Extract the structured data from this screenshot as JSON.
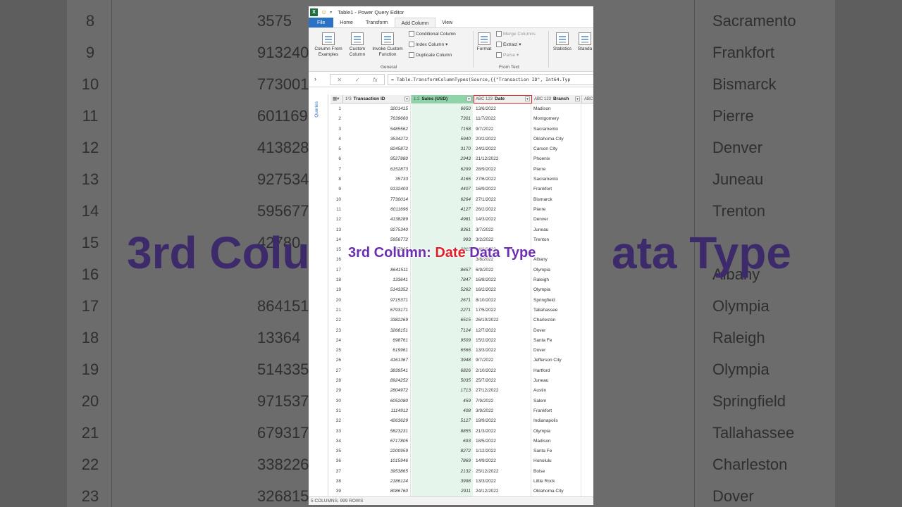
{
  "window": {
    "title": "Table1 - Power Query Editor"
  },
  "tabs": [
    {
      "label": "File"
    },
    {
      "label": "Home"
    },
    {
      "label": "Transform"
    },
    {
      "label": "Add Column"
    },
    {
      "label": "View"
    }
  ],
  "ribbon": {
    "column_from_examples": "Column From Examples",
    "custom_column": "Custom Column",
    "invoke_custom_function": "Invoke Custom Function",
    "conditional_column": "Conditional Column",
    "index_column": "Index Column",
    "duplicate_column": "Duplicate Column",
    "general_group": "General",
    "format": "Format",
    "merge_columns": "Merge Columns",
    "extract": "Extract",
    "parse": "Parse",
    "from_text_group": "From Text",
    "statistics": "Statistics",
    "standard": "Standa"
  },
  "formula": {
    "text": "= Table.TransformColumnTypes(Source,{{\"Transaction ID\", Int64.Typ"
  },
  "queries_label": "Queries",
  "columns": [
    {
      "type": "1²3",
      "name": "Transaction ID"
    },
    {
      "type": "1.2",
      "name": "Sales (USD)"
    },
    {
      "type": "ABC 123",
      "name": "Date"
    },
    {
      "type": "ABC 123",
      "name": "Branch"
    },
    {
      "type": "ABC 123",
      "name": ""
    }
  ],
  "rows": [
    [
      "1",
      "3201415",
      "6650",
      "13/6/2022",
      "Madison"
    ],
    [
      "2",
      "7639660",
      "7301",
      "11/7/2022",
      "Montgomery"
    ],
    [
      "3",
      "5485562",
      "7158",
      "9/7/2022",
      "Sacramento"
    ],
    [
      "4",
      "3534272",
      "5940",
      "20/2/2022",
      "Oklahoma City"
    ],
    [
      "5",
      "8245872",
      "3170",
      "24/2/2022",
      "Carson City"
    ],
    [
      "6",
      "9527880",
      "2943",
      "21/12/2022",
      "Phoenix"
    ],
    [
      "7",
      "6152873",
      "6299",
      "28/9/2022",
      "Pierre"
    ],
    [
      "8",
      "35733",
      "4166",
      "27/6/2022",
      "Sacramento"
    ],
    [
      "9",
      "9132403",
      "4407",
      "16/9/2022",
      "Frankfort"
    ],
    [
      "10",
      "7730014",
      "6264",
      "27/1/2022",
      "Bismarck"
    ],
    [
      "11",
      "6011696",
      "4127",
      "26/2/2022",
      "Pierre"
    ],
    [
      "12",
      "4138289",
      "4981",
      "14/3/2022",
      "Denver"
    ],
    [
      "13",
      "9275340",
      "8361",
      "3/7/2022",
      "Juneau"
    ],
    [
      "14",
      "5956772",
      "993",
      "3/2/2022",
      "Trenton"
    ],
    [
      "15",
      "427805",
      "8815",
      "24/3/2022",
      ""
    ],
    [
      "16",
      "",
      "",
      "3/8/2022",
      "Albany"
    ],
    [
      "17",
      "8641511",
      "8657",
      "6/9/2022",
      "Olympia"
    ],
    [
      "18",
      "133641",
      "7847",
      "16/8/2022",
      "Raleigh"
    ],
    [
      "19",
      "5143352",
      "5262",
      "16/2/2022",
      "Olympia"
    ],
    [
      "20",
      "9715371",
      "2671",
      "8/10/2022",
      "Springfield"
    ],
    [
      "21",
      "6793171",
      "2271",
      "17/5/2022",
      "Tallahassee"
    ],
    [
      "22",
      "3382269",
      "6515",
      "26/10/2022",
      "Charleston"
    ],
    [
      "23",
      "3268151",
      "7124",
      "12/7/2022",
      "Dover"
    ],
    [
      "24",
      "698761",
      "9509",
      "15/2/2022",
      "Santa Fe"
    ],
    [
      "25",
      "619961",
      "6566",
      "13/3/2022",
      "Dover"
    ],
    [
      "26",
      "4161367",
      "3948",
      "9/7/2022",
      "Jefferson City"
    ],
    [
      "27",
      "3839541",
      "6826",
      "2/10/2022",
      "Hartford"
    ],
    [
      "28",
      "8924252",
      "5035",
      "25/7/2022",
      "Juneau"
    ],
    [
      "29",
      "2804972",
      "1713",
      "27/12/2022",
      "Austin"
    ],
    [
      "30",
      "6052080",
      "459",
      "7/9/2022",
      "Salem"
    ],
    [
      "31",
      "1114912",
      "408",
      "3/9/2022",
      "Frankfort"
    ],
    [
      "32",
      "4263629",
      "5127",
      "19/9/2022",
      "Indianapolis"
    ],
    [
      "33",
      "5823231",
      "8855",
      "21/3/2022",
      "Olympia"
    ],
    [
      "34",
      "6717805",
      "693",
      "18/5/2022",
      "Madison"
    ],
    [
      "35",
      "2200959",
      "8272",
      "1/12/2022",
      "Santa Fe"
    ],
    [
      "36",
      "1015946",
      "7869",
      "14/9/2022",
      "Honolulu"
    ],
    [
      "37",
      "3953865",
      "2132",
      "25/12/2022",
      "Boise"
    ],
    [
      "38",
      "2186124",
      "3998",
      "13/3/2022",
      "Little Rock"
    ],
    [
      "39",
      "8086760",
      "2911",
      "24/12/2022",
      "Oklahoma City"
    ]
  ],
  "status": "5 COLUMNS, 999 ROWS",
  "caption": {
    "part1": "3rd Column: ",
    "part2": "Date",
    "part3": " Data Type"
  },
  "background": {
    "rows": [
      [
        "8",
        "3575",
        "Sacramento"
      ],
      [
        "9",
        "913240",
        "Frankfort"
      ],
      [
        "10",
        "773001",
        "Bismarck"
      ],
      [
        "11",
        "601169",
        "Pierre"
      ],
      [
        "12",
        "413828",
        "Denver"
      ],
      [
        "13",
        "927534",
        "Juneau"
      ],
      [
        "14",
        "595677",
        "Trenton"
      ],
      [
        "15",
        "42780",
        ""
      ],
      [
        "16",
        "",
        "Albany"
      ],
      [
        "17",
        "864151",
        "Olympia"
      ],
      [
        "18",
        "13364",
        "Raleigh"
      ],
      [
        "19",
        "514335",
        "Olympia"
      ],
      [
        "20",
        "971537",
        "Springfield"
      ],
      [
        "21",
        "679317",
        "Tallahassee"
      ],
      [
        "22",
        "338226",
        "Charleston"
      ],
      [
        "23",
        "326815",
        "Dover"
      ]
    ],
    "caption_left": "3rd Colu",
    "caption_right": "ata Type"
  }
}
